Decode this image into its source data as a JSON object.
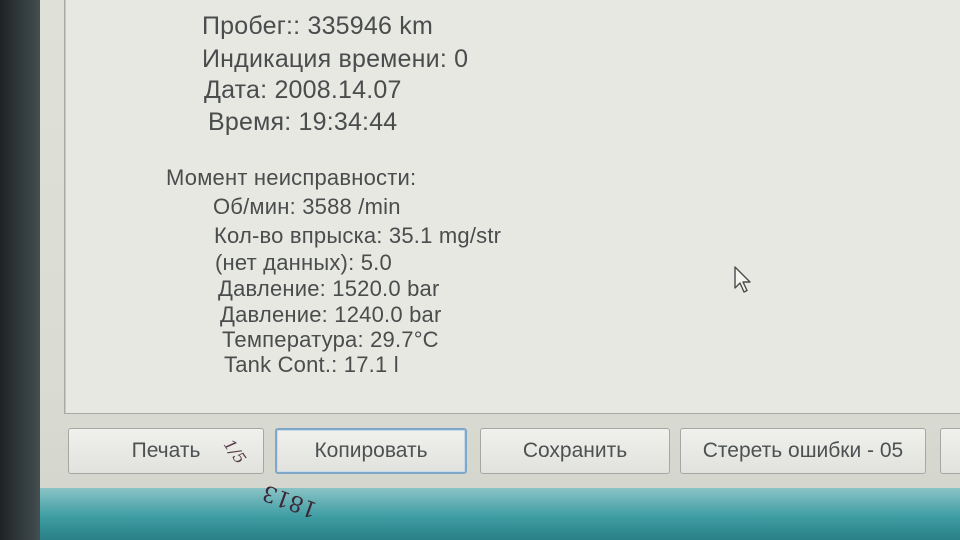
{
  "report": {
    "mileage": "Пробег:: 335946 km",
    "time_indication": "Индикация времени: 0",
    "date": "Дата: 2008.14.07",
    "time": "Время: 19:34:44",
    "fault_moment_title": "Момент неисправности:",
    "rpm": "Об/мин: 3588 /min",
    "injection_qty": "Кол-во впрыска: 35.1 mg/str",
    "no_data": "(нет данных): 5.0",
    "pressure_1": "Давление: 1520.0 bar",
    "pressure_2": "Давление: 1240.0 bar",
    "temperature": "Температура: 29.7°C",
    "tank_cont": "Tank Cont.: 17.1 l"
  },
  "buttons": {
    "print": "Печать",
    "copy": "Копировать",
    "save": "Сохранить",
    "clear_errors": "Стереть ошибки - 05"
  },
  "handwriting": {
    "mark": "1/5",
    "number": "1813"
  },
  "icons": {
    "cursor": "mouse-pointer-icon"
  },
  "colors": {
    "text": "#4a4d4d",
    "pane": "#e8e8e2",
    "taskbar": "#3d9da3",
    "focus_border": "#7fa8c8"
  }
}
